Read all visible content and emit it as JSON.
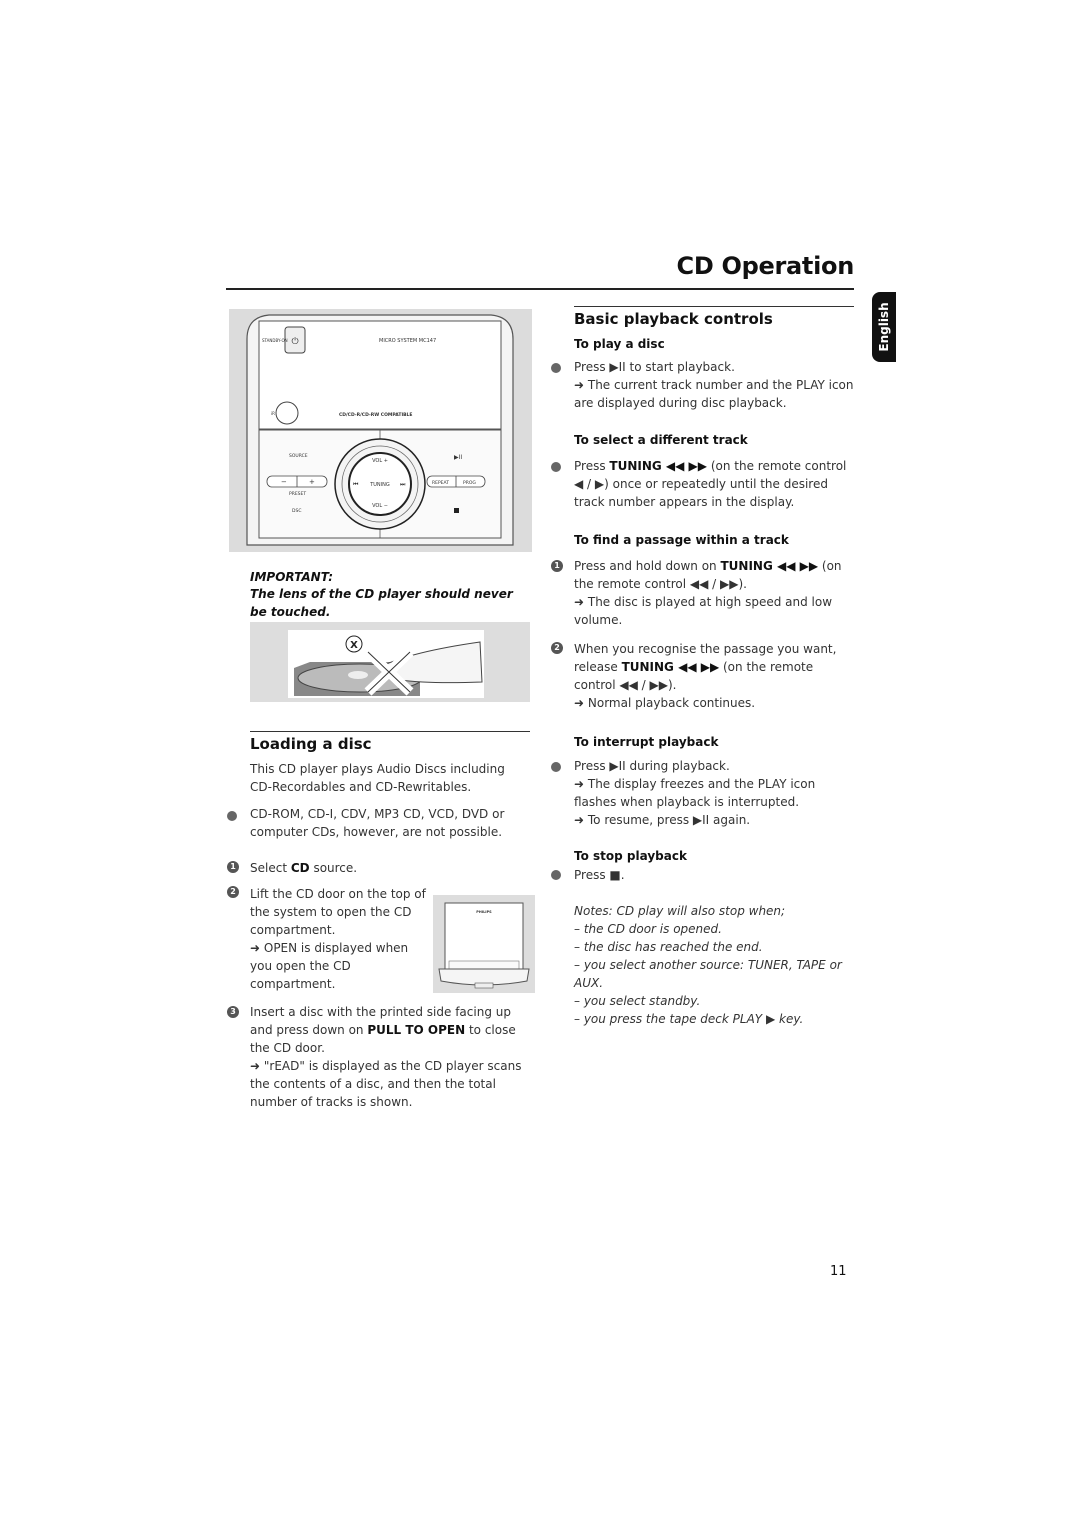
{
  "header": {
    "title": "CD Operation",
    "language_tab": "English"
  },
  "figure_device": {
    "standby_label": "STANDBY-ON",
    "model": "MICRO SYSTEM MC147",
    "ir_label": "iR",
    "compat": "CD/CD-R/CD-RW COMPATIBLE",
    "source": "SOURCE",
    "preset": "PRESET",
    "dsc": "DSC",
    "vol_plus": "VOL +",
    "vol_minus": "VOL −",
    "tuning": "TUNING",
    "repeat": "REPEAT",
    "prog": "PROG",
    "minus": "−",
    "plus": "+"
  },
  "important": {
    "label": "IMPORTANT:",
    "text": "The lens of the CD player should never be touched."
  },
  "loading": {
    "heading": "Loading a disc",
    "intro": "This CD player plays Audio Discs including CD-Recordables and CD-Rewritables.",
    "bullet": "CD-ROM, CD-I, CDV, MP3 CD, VCD, DVD or computer CDs, however, are not possible.",
    "steps": [
      {
        "num": "1",
        "pre": "Select ",
        "bold": "CD",
        "post": " source."
      },
      {
        "num": "2",
        "text": "Lift the CD door on the top of the system to open the CD compartment.",
        "arrow": "➜ OPEN is displayed when you open the CD compartment."
      },
      {
        "num": "3",
        "pre": "Insert a disc with the printed side facing up and press down on ",
        "bold": "PULL TO OPEN",
        "post": " to close the CD door.",
        "arrow": "➜ \"rEAD\" is displayed as the CD player scans the contents of a disc, and then the total number of tracks is shown."
      }
    ],
    "door_brand": "PHILIPS"
  },
  "basic": {
    "heading": "Basic playback controls",
    "play": {
      "heading": "To play a disc",
      "line": "Press ▶II to start playback.",
      "arrow": "➜ The current track number and the PLAY icon are displayed during disc playback."
    },
    "select": {
      "heading": "To select a different track",
      "pre": "Press ",
      "bold": "TUNING ◀◀ ▶▶",
      "post": " (on the remote control ◀ / ▶) once or repeatedly until the desired track number appears in the display."
    },
    "find": {
      "heading": "To find a passage within a track",
      "step1_pre": "Press and hold down on ",
      "step1_bold": "TUNING ◀◀ ▶▶",
      "step1_post": " (on the remote control ◀◀ / ▶▶).",
      "step1_arrow": "➜ The disc is played at high speed and low volume.",
      "step2_pre": "When you recognise the passage you want, release ",
      "step2_bold": "TUNING ◀◀ ▶▶",
      "step2_post": " (on the remote control ◀◀ / ▶▶).",
      "step2_arrow": "➜ Normal playback continues."
    },
    "interrupt": {
      "heading": "To interrupt playback",
      "line": "Press ▶II during playback.",
      "arrow1": "➜ The display freezes and the PLAY icon flashes when playback is interrupted.",
      "arrow2": "➜ To resume, press ▶II again."
    },
    "stop": {
      "heading": "To stop playback",
      "line": "Press ■."
    },
    "notes": [
      "Notes: CD play will also stop when;",
      "– the CD door is opened.",
      "– the disc has reached the end.",
      "– you select another source: TUNER, TAPE or AUX.",
      "– you select standby.",
      "– you press the tape deck PLAY ▶ key."
    ]
  },
  "page_number": "11"
}
